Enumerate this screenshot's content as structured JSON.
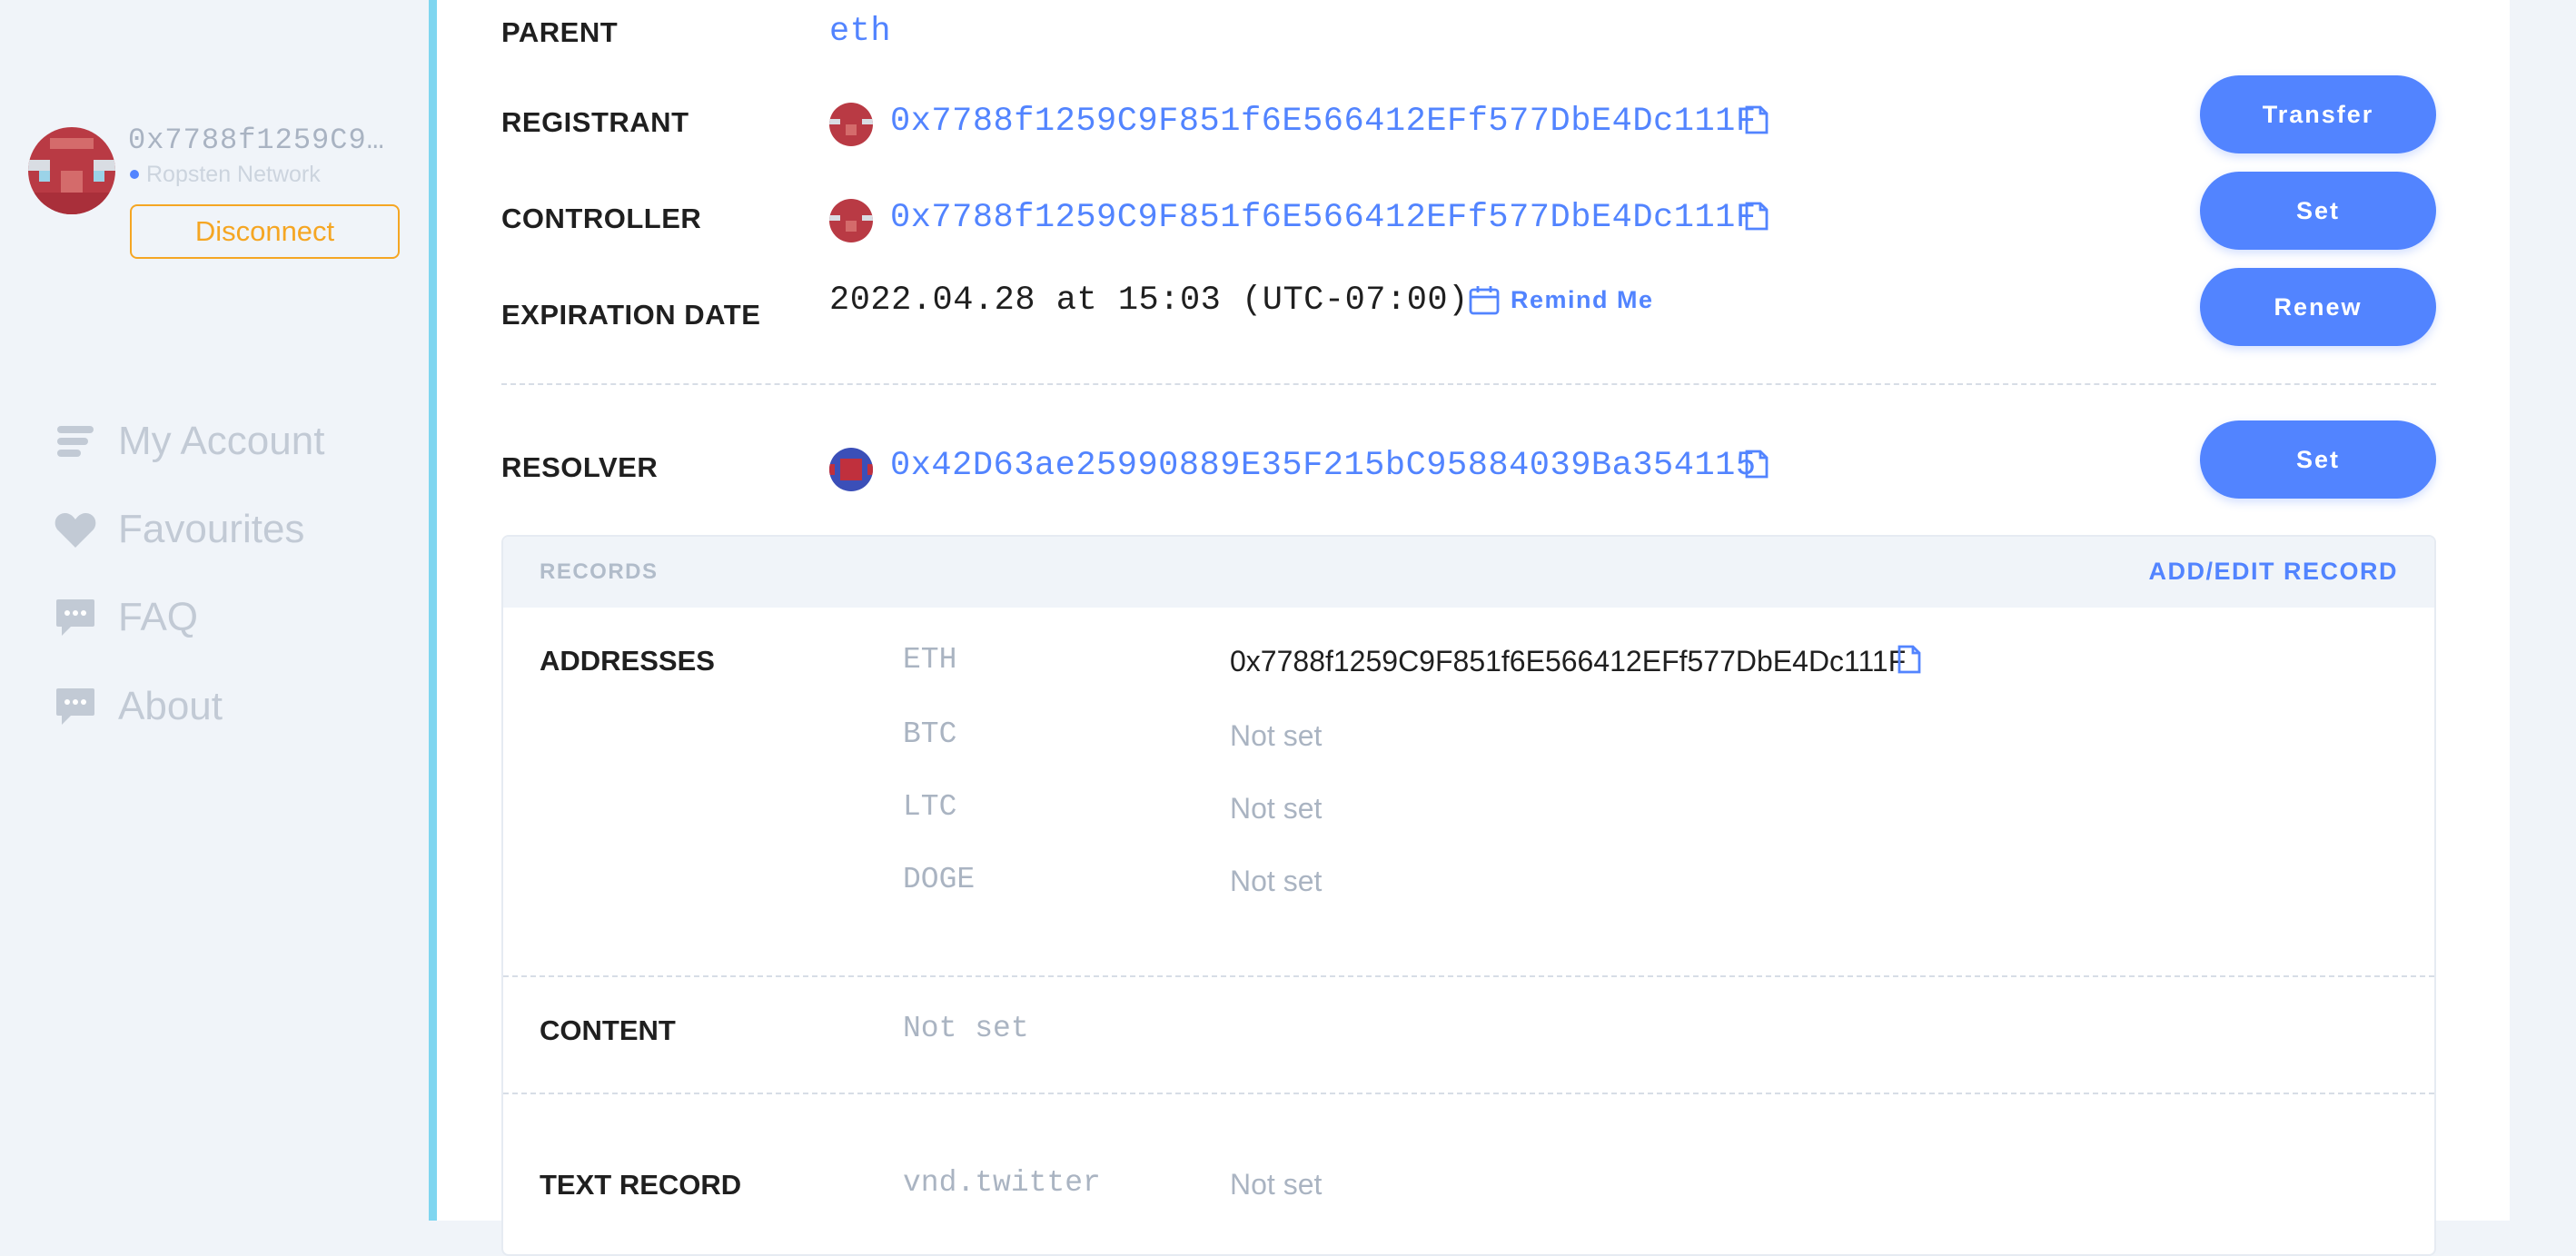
{
  "sidebar": {
    "account_address": "0x7788f1259C9…",
    "network": "Ropsten Network",
    "disconnect_label": "Disconnect",
    "nav": [
      {
        "label": "My Account",
        "icon": "list-icon"
      },
      {
        "label": "Favourites",
        "icon": "heart-icon"
      },
      {
        "label": "FAQ",
        "icon": "chat-bubble-icon"
      },
      {
        "label": "About",
        "icon": "chat-bubble-icon"
      }
    ]
  },
  "details": {
    "parent": {
      "label": "PARENT",
      "value": "eth"
    },
    "registrant": {
      "label": "REGISTRANT",
      "address": "0x7788f1259C9F851f6E566412EFf577DbE4Dc111F",
      "button": "Transfer"
    },
    "controller": {
      "label": "CONTROLLER",
      "address": "0x7788f1259C9F851f6E566412EFf577DbE4Dc111F",
      "button": "Set"
    },
    "expiration": {
      "label": "EXPIRATION DATE",
      "value": "2022.04.28 at 15:03 (UTC-07:00)",
      "remind": "Remind Me",
      "button": "Renew"
    },
    "resolver": {
      "label": "RESOLVER",
      "address": "0x42D63ae25990889E35F215bC95884039Ba354115",
      "button": "Set"
    }
  },
  "records": {
    "title": "RECORDS",
    "add_edit": "ADD/EDIT RECORD",
    "addresses": {
      "label": "ADDRESSES",
      "rows": [
        {
          "coin": "ETH",
          "value": "0x7788f1259C9F851f6E566412EFf577DbE4Dc111F"
        },
        {
          "coin": "BTC",
          "value": "Not set"
        },
        {
          "coin": "LTC",
          "value": "Not set"
        },
        {
          "coin": "DOGE",
          "value": "Not set"
        }
      ]
    },
    "content": {
      "label": "CONTENT",
      "value": "Not set"
    },
    "text_record": {
      "label": "TEXT RECORD",
      "key": "vnd.twitter",
      "value": "Not set"
    }
  },
  "colors": {
    "accent": "#5284ff",
    "warning": "#f5a623",
    "sidebar_border": "#7fd6f0"
  }
}
